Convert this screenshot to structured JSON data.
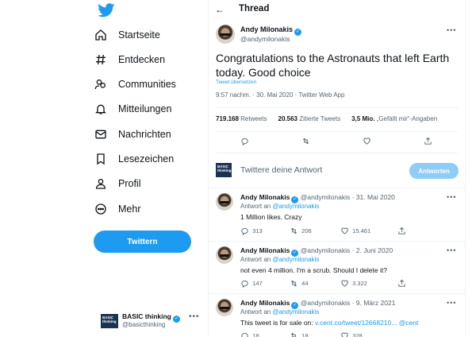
{
  "sidebar": {
    "nav": [
      {
        "label": "Startseite",
        "icon": "home-icon"
      },
      {
        "label": "Entdecken",
        "icon": "hashtag-icon"
      },
      {
        "label": "Communities",
        "icon": "communities-icon"
      },
      {
        "label": "Mitteilungen",
        "icon": "bell-icon"
      },
      {
        "label": "Nachrichten",
        "icon": "mail-icon"
      },
      {
        "label": "Lesezeichen",
        "icon": "bookmark-icon"
      },
      {
        "label": "Profil",
        "icon": "person-icon"
      },
      {
        "label": "Mehr",
        "icon": "more-circle-icon"
      }
    ],
    "tweet_button": "Twittern",
    "account": {
      "name": "BASIC thinking",
      "handle": "@basicthinking",
      "avatar_text": "BASIC thinking"
    }
  },
  "header": {
    "title": "Thread"
  },
  "main_tweet": {
    "name": "Andy Milonakis",
    "handle": "@andymilonakis",
    "text": "Congratulations to the Astronauts that left Earth today. Good choice",
    "translate": "Tweet übersetzen",
    "timestamp": "9:57 nachm. · 30. Mai 2020 · Twitter Web App",
    "stats": {
      "retweets_count": "719.168",
      "retweets_label": "Retweets",
      "quotes_count": "20.563",
      "quotes_label": "Zitierte Tweets",
      "likes_count": "3,5 Mio.",
      "likes_label": "„Gefällt mir“-Angaben"
    }
  },
  "reply_box": {
    "placeholder": "Twittere deine Antwort",
    "button": "Antworten"
  },
  "replies": [
    {
      "name": "Andy Milonakis",
      "handle_date": "@andymilonakis · 31. Mai 2020",
      "reply_to_prefix": "Antwort an",
      "reply_to": "@andymilonakis",
      "text": "1 Million likes. Crazy",
      "link": "",
      "comments": "313",
      "retweets": "206",
      "likes": "15.461"
    },
    {
      "name": "Andy Milonakis",
      "handle_date": "@andymilonakis · 2. Juni 2020",
      "reply_to_prefix": "Antwort an",
      "reply_to": "@andymilonakis",
      "text": "not even 4 million. I'm a scrub. Should I delete it?",
      "link": "",
      "comments": "147",
      "retweets": "44",
      "likes": "3.322"
    },
    {
      "name": "Andy Milonakis",
      "handle_date": "@andymilonakis · 9. März 2021",
      "reply_to_prefix": "Antwort an",
      "reply_to": "@andymilonakis",
      "text": "This tweet is for sale on: ",
      "link": "v.cent.co/tweet/12668210... @cent",
      "comments": "18",
      "retweets": "18",
      "likes": "328"
    }
  ],
  "colors": {
    "accent": "#1d9bf0",
    "text": "#0f1419",
    "muted": "#536471"
  }
}
